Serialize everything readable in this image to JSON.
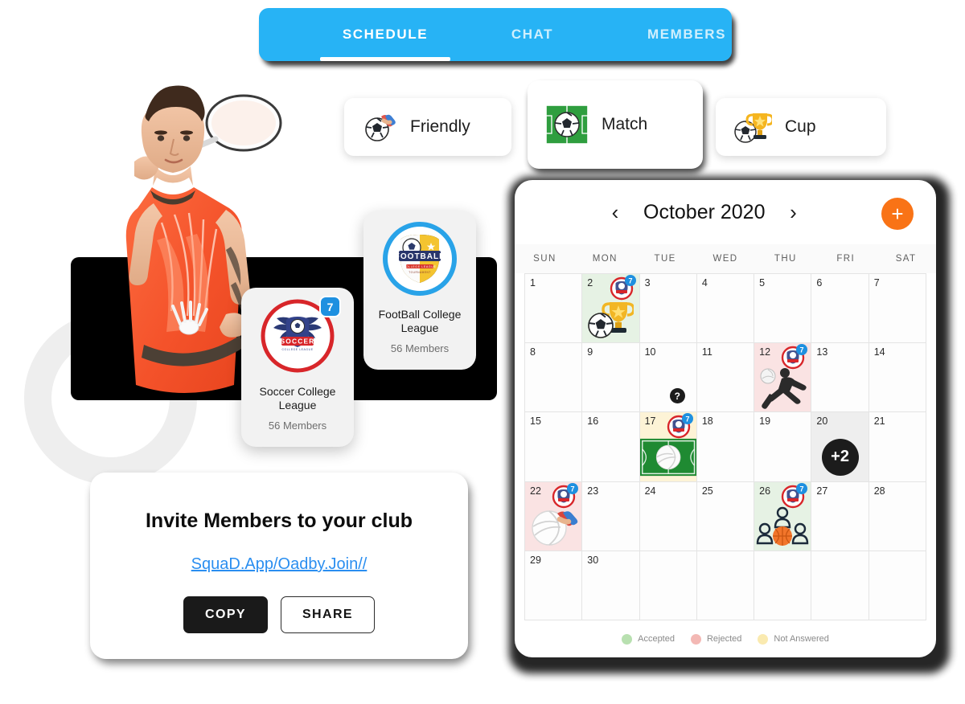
{
  "tabs": [
    {
      "label": "SCHEDULE",
      "active": true
    },
    {
      "label": "CHAT",
      "active": false
    },
    {
      "label": "MEMBERS",
      "active": false
    }
  ],
  "event_types": [
    {
      "label": "Friendly",
      "icon": "soccer-ball-handshake-icon",
      "selected": false
    },
    {
      "label": "Match",
      "icon": "soccer-pitch-ball-icon",
      "selected": true
    },
    {
      "label": "Cup",
      "icon": "soccer-ball-trophy-icon",
      "selected": false
    }
  ],
  "clubs": [
    {
      "name": "FootBall College League",
      "members": "56 Members",
      "badge": null,
      "logo": "football-college-crest-icon"
    },
    {
      "name": "Soccer College League",
      "members": "56 Members",
      "badge": "7",
      "logo": "soccer-college-crest-icon"
    }
  ],
  "invite": {
    "title": "Invite Members to your club",
    "link": "SquaD.App/Oadby.Join//",
    "copy_label": "COPY",
    "share_label": "SHARE"
  },
  "calendar": {
    "title": "October 2020",
    "prev_icon": "chevron-left-icon",
    "next_icon": "chevron-right-icon",
    "add_label": "+",
    "dow": [
      "SUN",
      "MON",
      "TUE",
      "WED",
      "THU",
      "FRI",
      "SAT"
    ],
    "legend": [
      {
        "label": "Accepted",
        "color": "#b8e0b0"
      },
      {
        "label": "Rejected",
        "color": "#f3b8b4"
      },
      {
        "label": "Not Answered",
        "color": "#faeab0"
      }
    ],
    "cells": [
      {
        "num": "1",
        "status": "none"
      },
      {
        "num": "2",
        "status": "accepted",
        "badge": "7",
        "art": "ball-trophy-icon"
      },
      {
        "num": "3",
        "status": "none"
      },
      {
        "num": "4",
        "status": "none"
      },
      {
        "num": "5",
        "status": "none"
      },
      {
        "num": "6",
        "status": "none"
      },
      {
        "num": "7",
        "status": "none"
      },
      {
        "num": "8",
        "status": "none"
      },
      {
        "num": "9",
        "status": "none"
      },
      {
        "num": "10",
        "status": "none",
        "marker": "?"
      },
      {
        "num": "11",
        "status": "none"
      },
      {
        "num": "12",
        "status": "rejected",
        "badge": "7",
        "art": "player-silhouette-ball-icon"
      },
      {
        "num": "13",
        "status": "none"
      },
      {
        "num": "14",
        "status": "none"
      },
      {
        "num": "15",
        "status": "none"
      },
      {
        "num": "16",
        "status": "none"
      },
      {
        "num": "17",
        "status": "pending",
        "badge": "7",
        "art": "pitch-volleyball-icon"
      },
      {
        "num": "18",
        "status": "none"
      },
      {
        "num": "19",
        "status": "none"
      },
      {
        "num": "20",
        "status": "more",
        "overflow": "+2"
      },
      {
        "num": "21",
        "status": "none"
      },
      {
        "num": "22",
        "status": "rejected",
        "badge": "7",
        "art": "volleyball-handshake-icon"
      },
      {
        "num": "23",
        "status": "none"
      },
      {
        "num": "24",
        "status": "none"
      },
      {
        "num": "25",
        "status": "none"
      },
      {
        "num": "26",
        "status": "accepted",
        "badge": "7",
        "art": "team-basketball-icon"
      },
      {
        "num": "27",
        "status": "none"
      },
      {
        "num": "28",
        "status": "none"
      },
      {
        "num": "29",
        "status": "none"
      },
      {
        "num": "30",
        "status": "none"
      },
      {
        "num": "",
        "status": "none"
      },
      {
        "num": "",
        "status": "none"
      },
      {
        "num": "",
        "status": "none"
      },
      {
        "num": "",
        "status": "none"
      },
      {
        "num": "",
        "status": "none"
      }
    ]
  }
}
